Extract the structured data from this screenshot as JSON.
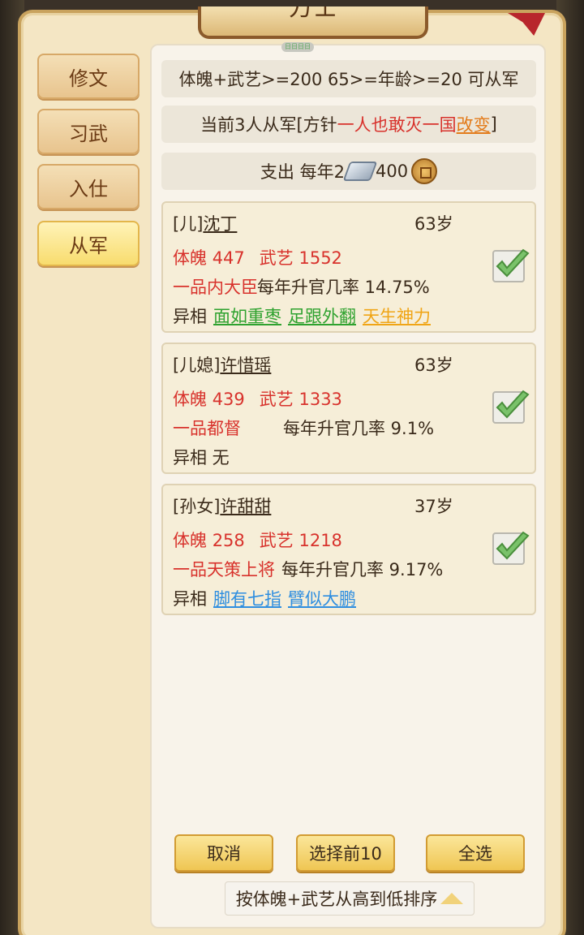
{
  "header": {
    "title": "方士"
  },
  "sidebar": {
    "items": [
      {
        "label": "修文"
      },
      {
        "label": "习武"
      },
      {
        "label": "入仕"
      },
      {
        "label": "从军",
        "active": true
      }
    ]
  },
  "panel": {
    "top_pill": "日日日日",
    "requirement": "体魄+武艺>=200 65>=年龄>=20 可从军",
    "current": {
      "prefix": "当前3人从军[方针",
      "policy": "一人也敢灭一国",
      "change": "改变",
      "suffix": "]"
    },
    "expense": {
      "label": "支出 每年2",
      "silver_icon": "silver-ingot-icon",
      "amount": "400",
      "coin_icon": "copper-coin-icon"
    }
  },
  "members": [
    {
      "relation": "[儿]",
      "name": "沈丁",
      "age": "63岁",
      "stats": {
        "tipo_label": "体魄",
        "tipo": "447",
        "wuyi_label": "武艺",
        "wuyi": "1552"
      },
      "rank": "一品内大臣",
      "rate": "每年升官几率 14.75%",
      "trait_label": "异相",
      "traits": [
        {
          "text": "面如重枣",
          "color": "green"
        },
        {
          "text": "足跟外翻",
          "color": "green"
        },
        {
          "text": "天生神力",
          "color": "gold"
        }
      ],
      "checked": true
    },
    {
      "relation": "[儿媳]",
      "name": "许惜瑶",
      "age": "63岁",
      "stats": {
        "tipo_label": "体魄",
        "tipo": "439",
        "wuyi_label": "武艺",
        "wuyi": "1333"
      },
      "rank": "一品都督",
      "rate": "每年升官几率 9.1%",
      "trait_label": "异相 无",
      "traits": [],
      "checked": true
    },
    {
      "relation": "[孙女]",
      "name": "许甜甜",
      "age": "37岁",
      "stats": {
        "tipo_label": "体魄",
        "tipo": "258",
        "wuyi_label": "武艺",
        "wuyi": "1218"
      },
      "rank": "一品天策上将",
      "rate": "每年升官几率 9.17%",
      "trait_label": "异相",
      "traits": [
        {
          "text": "脚有七指",
          "color": "blue"
        },
        {
          "text": "臂似大鹏",
          "color": "blue"
        }
      ],
      "checked": true
    }
  ],
  "buttons": {
    "cancel": "取消",
    "select_top10": "选择前10",
    "select_all": "全选"
  },
  "sort": {
    "label": "按体魄+武艺从高到低排序",
    "icon": "triangle-up-icon"
  },
  "colors": {
    "frame_bg": "#f4e6c4",
    "accent_red": "#d8322c",
    "trait_green": "#2fa22f",
    "trait_gold": "#f0a516",
    "trait_blue": "#2e8ee0",
    "button_gold": "#efc653"
  }
}
